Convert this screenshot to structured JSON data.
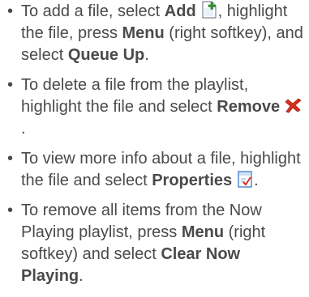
{
  "items": [
    {
      "t1": "To add a file, select ",
      "b1": "Add",
      "t2": ", highlight the file, press ",
      "b2": "Menu",
      "t3": " (right softkey), and select ",
      "b3": "Queue Up",
      "t4": ".",
      "icon": "add-file-icon"
    },
    {
      "t1": "To delete a file from the playlist, highlight the file and select ",
      "b1": "Remove",
      "t2": ".",
      "icon": "remove-x-icon"
    },
    {
      "t1": "To view more info about a file, highlight the file and select ",
      "b1": "Properties",
      "t2": ".",
      "icon": "properties-icon"
    },
    {
      "t1": "To remove all items from the Now Playing playlist, press ",
      "b1": "Menu",
      "t2": " (right softkey) and select ",
      "b2": "Clear Now Playing",
      "t3": "."
    }
  ],
  "colors": {
    "text": "#4a4a4a",
    "remove_icon": "#d8311c",
    "add_icon_green": "#2f9a2f",
    "properties_icon_blue": "#3a78c8"
  }
}
